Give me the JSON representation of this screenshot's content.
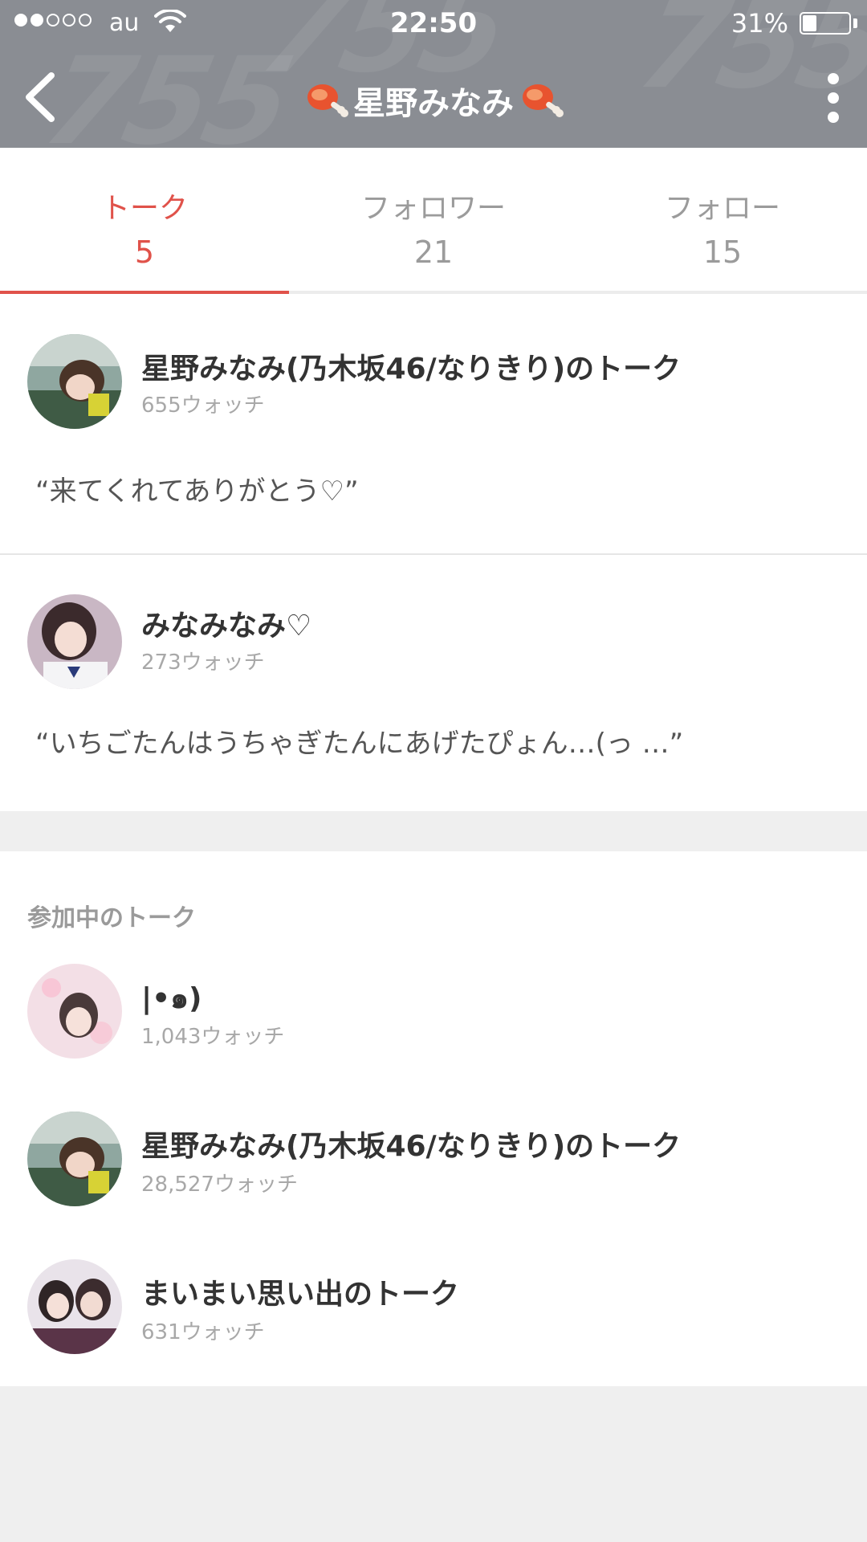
{
  "status_bar": {
    "carrier": "au",
    "time": "22:50",
    "battery_percent": "31%",
    "battery_level": 0.31,
    "signal_bars_filled": 2,
    "signal_bars_total": 5
  },
  "nav": {
    "title": "星野みなみ",
    "watermark": "755"
  },
  "tabs": [
    {
      "label": "トーク",
      "count": "5",
      "active": true
    },
    {
      "label": "フォロワー",
      "count": "21",
      "active": false
    },
    {
      "label": "フォロー",
      "count": "15",
      "active": false
    }
  ],
  "own_talks": [
    {
      "title": "星野みなみ(乃木坂46/なりきり)のトーク",
      "watch": "655ウォッチ",
      "quote": "“来てくれてありがとう♡”"
    },
    {
      "title": "みなみなみ♡",
      "watch": "273ウォッチ",
      "quote": "“いちごたんはうちゃぎたんにあげたぴょん…(っ …”"
    }
  ],
  "joined": {
    "heading": "参加中のトーク",
    "talks": [
      {
        "title": "|•๑)",
        "watch": "1,043ウォッチ"
      },
      {
        "title": "星野みなみ(乃木坂46/なりきり)のトーク",
        "watch": "28,527ウォッチ"
      },
      {
        "title": "まいまい思い出のトーク",
        "watch": "631ウォッチ"
      }
    ]
  },
  "colors": {
    "accent": "#e0524a",
    "header_bg": "#8a8d93",
    "page_bg": "#efefef"
  }
}
